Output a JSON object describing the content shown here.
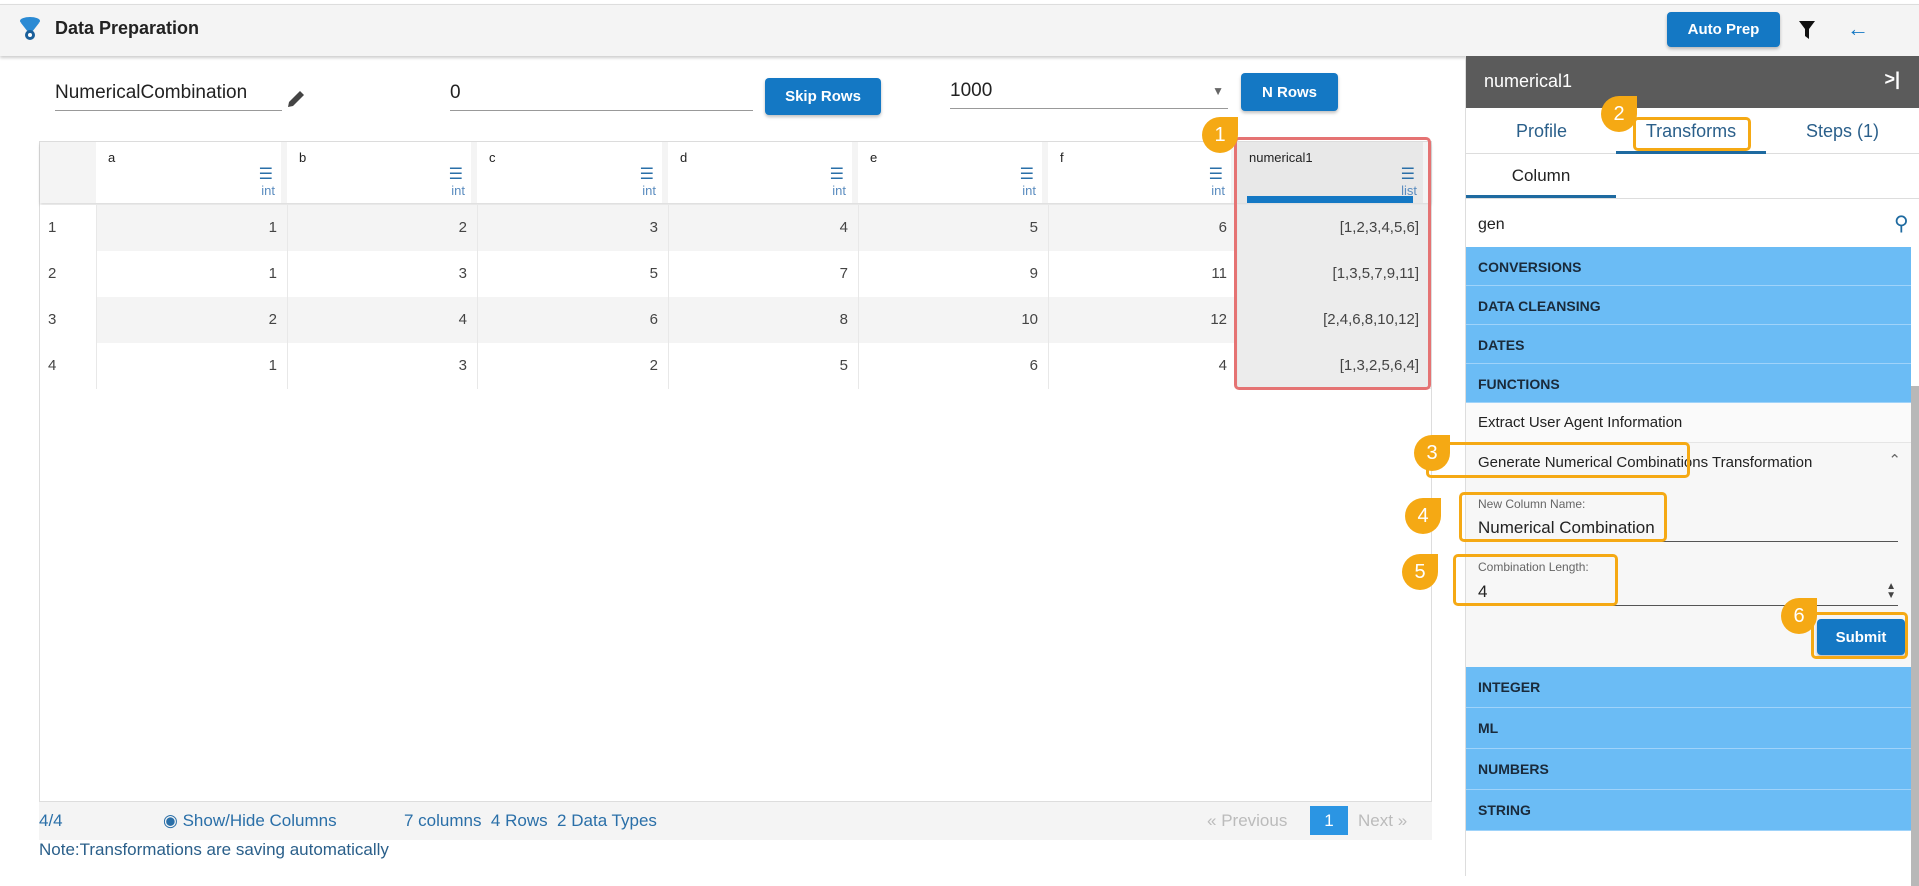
{
  "header": {
    "title": "Data Preparation",
    "auto_prep": "Auto Prep"
  },
  "toolbar": {
    "dataset_name": "NumericalCombination",
    "skip_value": "0",
    "skip_rows": "Skip Rows",
    "n_value": "1000",
    "n_rows": "N Rows"
  },
  "table": {
    "columns": [
      {
        "name": "a",
        "type": "int"
      },
      {
        "name": "b",
        "type": "int"
      },
      {
        "name": "c",
        "type": "int"
      },
      {
        "name": "d",
        "type": "int"
      },
      {
        "name": "e",
        "type": "int"
      },
      {
        "name": "f",
        "type": "int"
      },
      {
        "name": "numerical1",
        "type": "list"
      }
    ],
    "rows": [
      [
        "1",
        "1",
        "2",
        "3",
        "4",
        "5",
        "6",
        "[1,2,3,4,5,6]"
      ],
      [
        "2",
        "1",
        "3",
        "5",
        "7",
        "9",
        "11",
        "[1,3,5,7,9,11]"
      ],
      [
        "3",
        "2",
        "4",
        "6",
        "8",
        "10",
        "12",
        "[2,4,6,8,10,12]"
      ],
      [
        "4",
        "1",
        "3",
        "2",
        "5",
        "6",
        "4",
        "[1,3,2,5,6,4]"
      ]
    ]
  },
  "footer": {
    "count": "4/4",
    "show_hide": "Show/Hide Columns",
    "summary": "7 columns  4 Rows  2 Data Types",
    "previous": "Previous",
    "page": "1",
    "next": "Next",
    "note": "Note:Transformations are saving automatically"
  },
  "panel": {
    "title": "numerical1",
    "tabs": [
      "Profile",
      "Transforms",
      "Steps (1)"
    ],
    "subtab": "Column",
    "search": "gen",
    "categories_top": [
      "CONVERSIONS",
      "DATA CLEANSING",
      "DATES",
      "FUNCTIONS"
    ],
    "items": [
      "Extract User Agent Information",
      "Generate Numerical Combinations Transformation"
    ],
    "form": {
      "col_label": "New Column Name:",
      "col_value": "Numerical Combination",
      "len_label": "Combination Length:",
      "len_value": "4",
      "submit": "Submit"
    },
    "categories_bottom": [
      "INTEGER",
      "ML",
      "NUMBERS",
      "STRING"
    ]
  },
  "callouts": [
    "1",
    "2",
    "3",
    "4",
    "5",
    "6"
  ],
  "colors": {
    "accent": "#1478c4",
    "category": "#6bbcf5",
    "callout": "#f5a914",
    "highlight": "#e57373"
  }
}
